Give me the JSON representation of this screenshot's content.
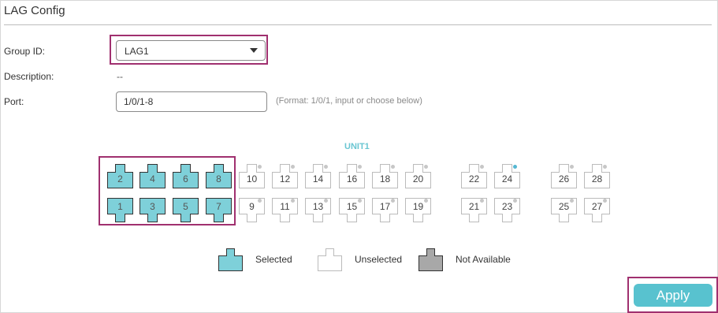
{
  "panel": {
    "title": "LAG Config"
  },
  "form": {
    "group_id_label": "Group ID:",
    "group_id_value": "LAG1",
    "description_label": "Description:",
    "description_value": "--",
    "port_label": "Port:",
    "port_value": "1/0/1-8",
    "port_hint": "(Format: 1/0/1, input or choose below)"
  },
  "unit": {
    "title": "UNIT1",
    "ports_top": [
      {
        "num": "2",
        "state": "selected"
      },
      {
        "num": "4",
        "state": "selected"
      },
      {
        "num": "6",
        "state": "selected"
      },
      {
        "num": "8",
        "state": "selected"
      },
      {
        "num": "10",
        "state": "unselected"
      },
      {
        "num": "12",
        "state": "unselected"
      },
      {
        "num": "14",
        "state": "unselected"
      },
      {
        "num": "16",
        "state": "unselected"
      },
      {
        "num": "18",
        "state": "unselected"
      },
      {
        "num": "20",
        "state": "unselected"
      },
      {
        "num": "22",
        "state": "unselected"
      },
      {
        "num": "24",
        "state": "unselected",
        "link": true
      },
      {
        "num": "26",
        "state": "unselected"
      },
      {
        "num": "28",
        "state": "unselected"
      }
    ],
    "ports_bottom": [
      {
        "num": "1",
        "state": "selected"
      },
      {
        "num": "3",
        "state": "selected"
      },
      {
        "num": "5",
        "state": "selected"
      },
      {
        "num": "7",
        "state": "selected"
      },
      {
        "num": "9",
        "state": "unselected"
      },
      {
        "num": "11",
        "state": "unselected"
      },
      {
        "num": "13",
        "state": "unselected"
      },
      {
        "num": "15",
        "state": "unselected"
      },
      {
        "num": "17",
        "state": "unselected"
      },
      {
        "num": "19",
        "state": "unselected"
      },
      {
        "num": "21",
        "state": "unselected"
      },
      {
        "num": "23",
        "state": "unselected"
      },
      {
        "num": "25",
        "state": "unselected"
      },
      {
        "num": "27",
        "state": "unselected"
      }
    ]
  },
  "legend": {
    "selected": "Selected",
    "unselected": "Unselected",
    "not_available": "Not Available"
  },
  "actions": {
    "apply_label": "Apply"
  },
  "colors": {
    "accent": "#58c2cf",
    "selected_fill": "#7ed0d9",
    "not_available_fill": "#a8a8a8",
    "highlight": "#a0306f"
  }
}
